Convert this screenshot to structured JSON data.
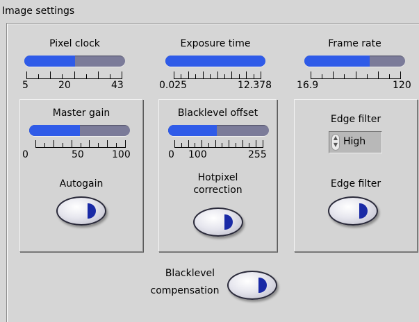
{
  "panel": {
    "title": "Image settings"
  },
  "pixel_clock": {
    "label": "Pixel clock",
    "fill": 0.5,
    "scale": [
      "5",
      "20",
      "43"
    ]
  },
  "exposure_time": {
    "label": "Exposure time",
    "fill": 1.0,
    "scale": [
      "0.025",
      "12.378"
    ]
  },
  "frame_rate": {
    "label": "Frame rate",
    "fill": 0.65,
    "scale": [
      "16.9",
      "120"
    ]
  },
  "master_gain": {
    "label": "Master gain",
    "fill": 0.5,
    "scale": [
      "0",
      "50",
      "100"
    ],
    "autogain_label": "Autogain"
  },
  "blacklevel_offset": {
    "label": "Blacklevel offset",
    "fill": 0.48,
    "scale": [
      "0",
      "100",
      "255"
    ],
    "hotpixel_label_line1": "Hotpixel",
    "hotpixel_label_line2": "correction"
  },
  "edge_filter": {
    "label": "Edge filter",
    "value": "High",
    "button_label": "Edge filter"
  },
  "blacklevel_compensation": {
    "label_line1": "Blacklevel",
    "label_line2": "compensation"
  },
  "colors": {
    "slider_fill": "#2f5be8",
    "slider_track": "#7b7b99",
    "indicator": "#1a2aa6"
  }
}
